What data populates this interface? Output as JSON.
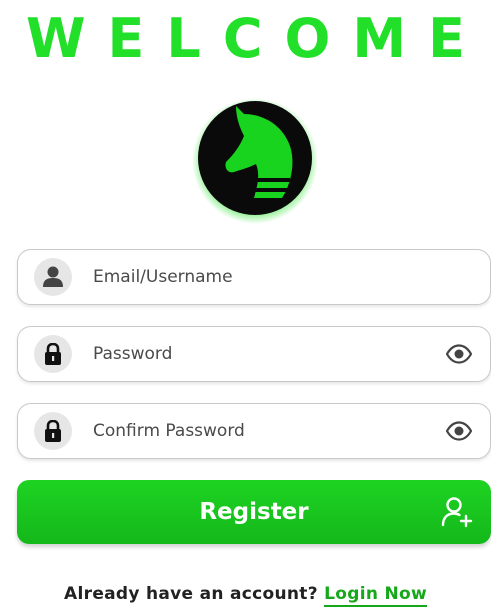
{
  "header": {
    "title": "WELCOME"
  },
  "form": {
    "email": {
      "placeholder": "Email/Username",
      "value": "",
      "icon": "user-icon"
    },
    "password": {
      "placeholder": "Password",
      "value": "",
      "icon": "lock-icon",
      "toggle_icon": "eye-icon"
    },
    "confirm_password": {
      "placeholder": "Confirm Password",
      "value": "",
      "icon": "lock-icon",
      "toggle_icon": "eye-icon"
    }
  },
  "register_button": {
    "label": "Register",
    "icon": "add-user-icon"
  },
  "footer": {
    "prompt": "Already have an account?",
    "link": "Login Now"
  },
  "colors": {
    "accent": "#22e02a",
    "button": "#16c01c",
    "link": "#14a81a"
  }
}
